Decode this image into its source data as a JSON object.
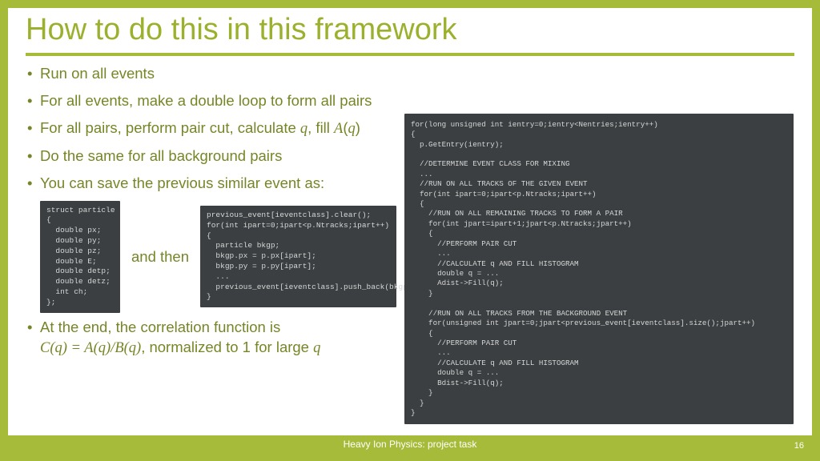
{
  "title": "How to do this in this framework",
  "bullets": {
    "b1": "Run on all events",
    "b2": "For all events, make a double loop to form all pairs",
    "b3_a": "For all pairs, perform pair cut, calculate ",
    "b3_q": "q",
    "b3_b": ", fill ",
    "b3_A": "A",
    "b3_c": "(",
    "b3_q2": "q",
    "b3_d": ")",
    "b4": "Do the same for all background pairs",
    "b5": "You can save the previous similar event as:",
    "b6_a": "At the end, the correlation function is",
    "b6_eq": "C(q) = A(q)/B(q)",
    "b6_b": ", normalized to 1 for large ",
    "b6_q": "q"
  },
  "andthen": "and then",
  "code": {
    "struct": "struct particle\n{\n  double px;\n  double py;\n  double pz;\n  double E;\n  double detp;\n  double detz;\n  int ch;\n};",
    "copy": "previous_event[ieventclass].clear();\nfor(int ipart=0;ipart<p.Ntracks;ipart++)\n{\n  particle bkgp;\n  bkgp.px = p.px[ipart];\n  bkgp.py = p.py[ipart];\n  ...\n  previous_event[ieventclass].push_back(bkgp);\n}",
    "main": "for(long unsigned int ientry=0;ientry<Nentries;ientry++)\n{\n  p.GetEntry(ientry);\n\n  //DETERMINE EVENT CLASS FOR MIXING\n  ...\n  //RUN ON ALL TRACKS OF THE GIVEN EVENT\n  for(int ipart=0;ipart<p.Ntracks;ipart++)\n  {\n    //RUN ON ALL REMAINING TRACKS TO FORM A PAIR\n    for(int jpart=ipart+1;jpart<p.Ntracks;jpart++)\n    {\n      //PERFORM PAIR CUT\n      ...\n      //CALCULATE q AND FILL HISTOGRAM\n      double q = ...\n      Adist->Fill(q);\n    }\n\n    //RUN ON ALL TRACKS FROM THE BACKGROUND EVENT\n    for(unsigned int jpart=0;jpart<previous_event[ieventclass].size();jpart++)\n    {\n      //PERFORM PAIR CUT\n      ...\n      //CALCULATE q AND FILL HISTOGRAM\n      double q = ...\n      Bdist->Fill(q);\n    }\n  }\n}"
  },
  "footer": {
    "label": "Heavy Ion Physics: project task",
    "page": "16"
  }
}
